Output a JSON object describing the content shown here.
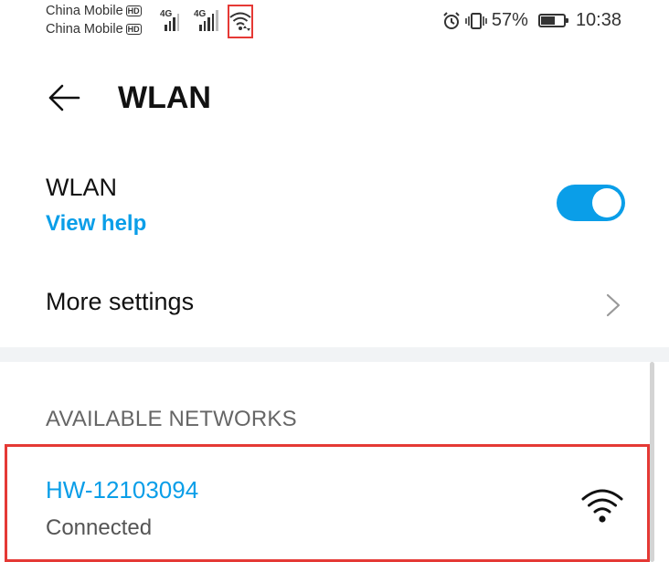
{
  "status_bar": {
    "carrier_1": "China Mobile",
    "carrier_2": "China Mobile",
    "hd_badge": "HD",
    "signal_1_label": "4G",
    "signal_2_label": "4G",
    "battery_percent": "57%",
    "time": "10:38",
    "icons": [
      "alarm-icon",
      "vibrate-icon",
      "battery-icon",
      "wifi-status-icon"
    ]
  },
  "header": {
    "title": "WLAN",
    "back_icon": "back-arrow-icon"
  },
  "wlan_setting": {
    "label": "WLAN",
    "help_link": "View help",
    "toggle_on": true
  },
  "more_settings": {
    "label": "More settings",
    "chevron_icon": "chevron-right-icon"
  },
  "networks": {
    "section_title": "AVAILABLE NETWORKS",
    "items": [
      {
        "name": "HW-12103094",
        "status": "Connected",
        "icon": "wifi-icon"
      }
    ]
  },
  "colors": {
    "accent": "#0a9ee8",
    "highlight": "#e53935"
  }
}
